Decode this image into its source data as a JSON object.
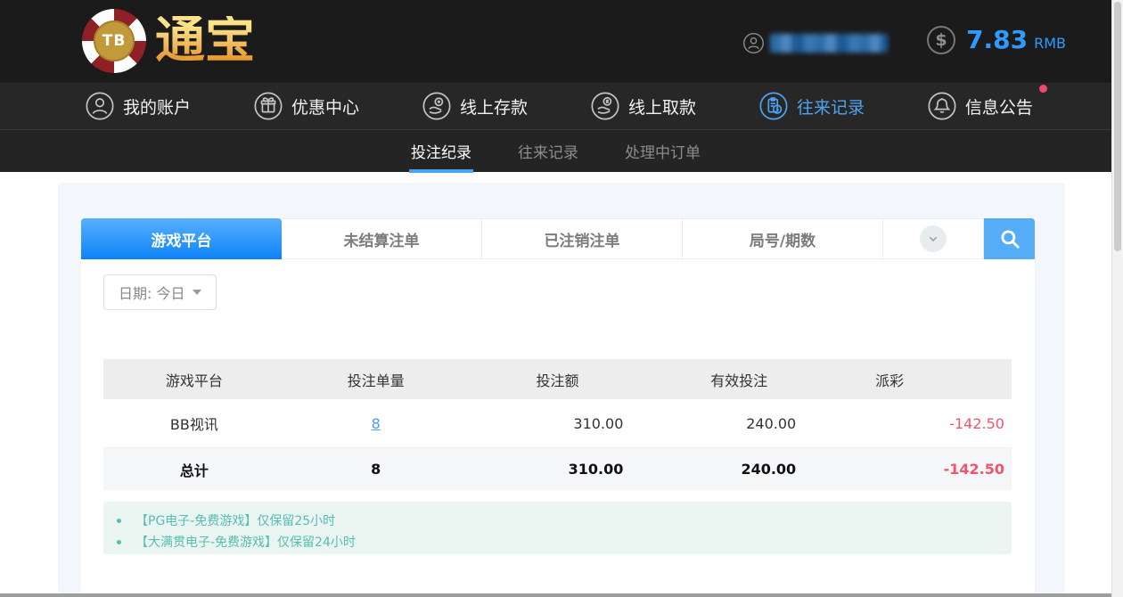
{
  "logo": {
    "chip_label": "TB",
    "brand": "通宝"
  },
  "header": {
    "balance": {
      "amount": "7.83",
      "currency": "RMB"
    },
    "icons": [
      "user-avatar-icon",
      "dollar-circle-icon"
    ],
    "username_masked": true
  },
  "nav": {
    "items": [
      {
        "label": "我的账户",
        "icon": "user-icon",
        "active": false
      },
      {
        "label": "优惠中心",
        "icon": "gift-icon",
        "active": false
      },
      {
        "label": "线上存款",
        "icon": "deposit-hand-coin-icon",
        "active": false
      },
      {
        "label": "线上取款",
        "icon": "withdraw-hand-coin-icon",
        "active": false
      },
      {
        "label": "往来记录",
        "icon": "records-clipboard-clock-icon",
        "active": true
      },
      {
        "label": "信息公告",
        "icon": "bell-icon",
        "active": false,
        "badge": "unread-dot"
      }
    ]
  },
  "subnav": {
    "items": [
      {
        "label": "投注纪录",
        "active": true
      },
      {
        "label": "往来记录",
        "active": false
      },
      {
        "label": "处理中订单",
        "active": false
      }
    ]
  },
  "filter_bar": {
    "tabs": [
      {
        "label": "游戏平台",
        "active": true
      },
      {
        "label": "未结算注单",
        "active": false
      },
      {
        "label": "已注销注单",
        "active": false
      },
      {
        "label": "局号/期数",
        "active": false
      }
    ],
    "dropdown_icon": "chevron-down-icon",
    "search_icon": "search-icon"
  },
  "date_filter": {
    "label": "日期: 今日"
  },
  "table": {
    "columns": [
      "游戏平台",
      "投注单量",
      "投注额",
      "有效投注",
      "派彩"
    ],
    "rows": [
      {
        "platform": "BB视讯",
        "bet_count": "8",
        "bet_amount": "310.00",
        "valid_bet": "240.00",
        "payout": "-142.50"
      }
    ],
    "total": {
      "label": "总计",
      "bet_count": "8",
      "bet_amount": "310.00",
      "valid_bet": "240.00",
      "payout": "-142.50"
    }
  },
  "notes": {
    "items": [
      "【PG电子-免费游戏】仅保留25小时",
      "【大满贯电子-免费游戏】仅保留24小时"
    ]
  },
  "colors": {
    "accent_blue": "#2f9bfe",
    "tab_gradient_top": "#58b0fe",
    "tab_gradient_bottom": "#0d83f7",
    "payout_red": "#f0556e",
    "note_teal": "#56bdb2",
    "badge_red": "#ec4a6a"
  }
}
